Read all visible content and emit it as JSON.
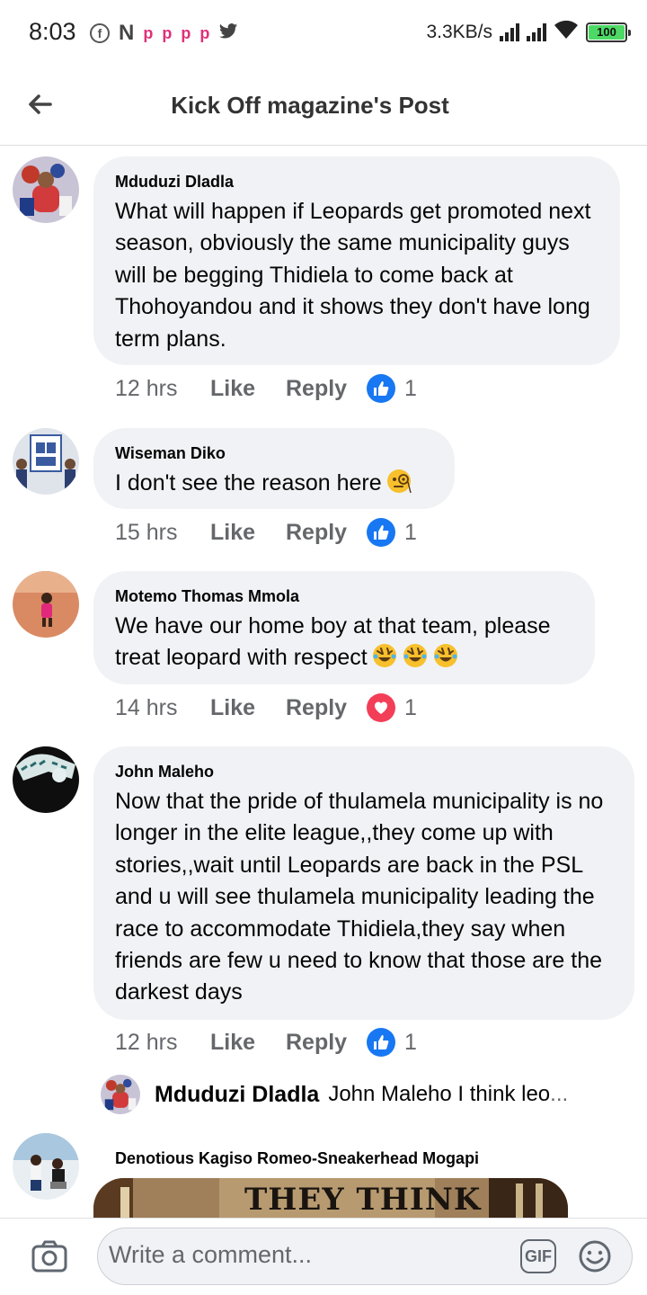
{
  "status_bar": {
    "time": "8:03",
    "net_speed": "3.3KB/s",
    "battery": "100",
    "left_icons": [
      "facebook-icon",
      "netflix-icon",
      "p-app-icon",
      "p-app-icon",
      "p-app-icon",
      "p-app-icon",
      "twitter-icon"
    ]
  },
  "header": {
    "title": "Kick Off magazine's Post",
    "back_icon": "back-arrow-icon"
  },
  "comments": [
    {
      "name": "Mduduzi Dladla",
      "text": "What will happen if Leopards get promoted next season, obviously the same municipality guys will be begging Thidiela to come back at Thohoyandou and it shows they don't have long term plans.",
      "time": "12 hrs",
      "like": "Like",
      "reply": "Reply",
      "reaction": "like",
      "reaction_count": "1"
    },
    {
      "name": "Wiseman Diko",
      "text": "I don't see the reason here",
      "emoji": "monocle-face-emoji",
      "time": "15 hrs",
      "like": "Like",
      "reply": "Reply",
      "reaction": "like",
      "reaction_count": "1"
    },
    {
      "name": "Motemo Thomas Mmola",
      "text": "We have our home boy at that team, please treat leopard with respect",
      "emoji": "rolling-laughing-emoji",
      "time": "14 hrs",
      "like": "Like",
      "reply": "Reply",
      "reaction": "love",
      "reaction_count": "1"
    },
    {
      "name": "John Maleho",
      "text": "Now that the pride of thulamela municipality is no longer in the elite league,,they come up with stories,,wait until Leopards are back in the PSL and u will see thulamela municipality leading the race to accommodate Thidiela,they say when friends are few u need to know that those are the darkest days",
      "time": "12 hrs",
      "like": "Like",
      "reply": "Reply",
      "reaction": "like",
      "reaction_count": "1"
    }
  ],
  "reply_preview": {
    "name": "Mduduzi Dladla",
    "text": "John Maleho I think leo",
    "ellipsis": "..."
  },
  "last_comment": {
    "name": "Denotious Kagiso Romeo-Sneakerhead Mogapi",
    "gif_text": "THEY THINK"
  },
  "composer": {
    "placeholder": "Write a comment...",
    "gif_label": "GIF"
  },
  "colors": {
    "like_blue": "#1877f2",
    "love_red": "#f33e58",
    "bubble_bg": "#f0f2f5",
    "meta_gray": "#65676b"
  }
}
